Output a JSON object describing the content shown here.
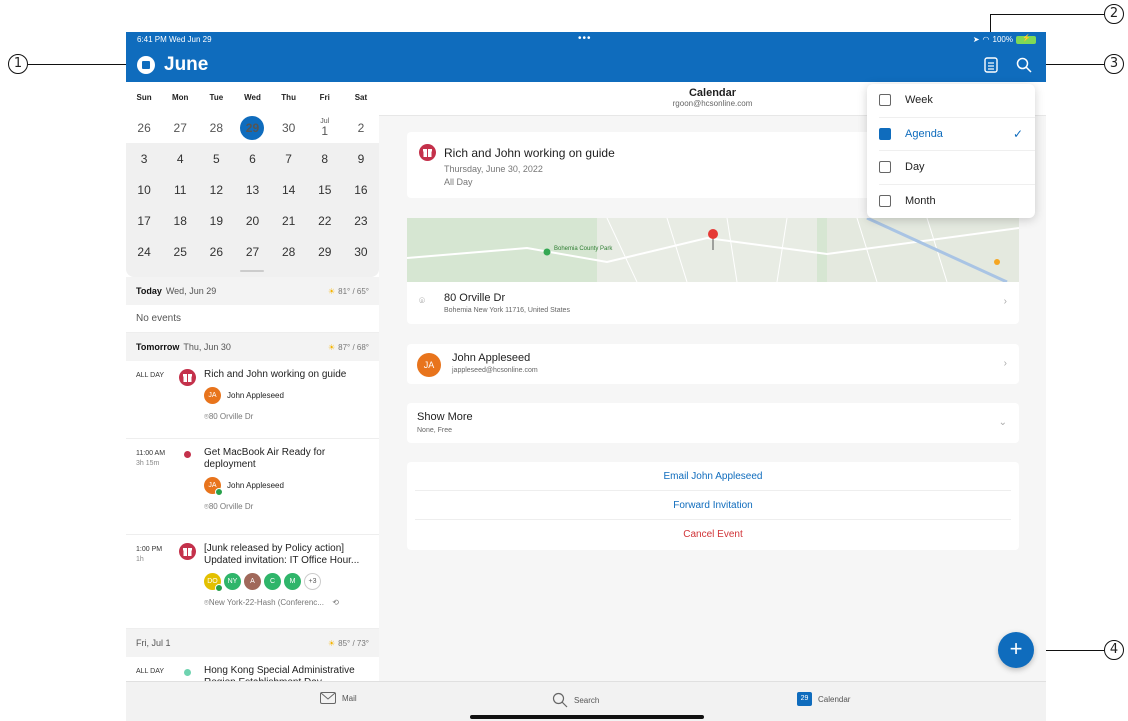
{
  "status": {
    "time": "6:41 PM  Wed Jun 29",
    "dots": "•••",
    "battery": "100%"
  },
  "appbar": {
    "month": "June"
  },
  "callouts": [
    "1",
    "2",
    "3",
    "4"
  ],
  "calendar": {
    "weekdays": [
      "Sun",
      "Mon",
      "Tue",
      "Wed",
      "Thu",
      "Fri",
      "Sat"
    ],
    "weeks": [
      [
        "26",
        "27",
        "28",
        "29",
        "30",
        "1",
        "2"
      ],
      [
        "3",
        "4",
        "5",
        "6",
        "7",
        "8",
        "9"
      ],
      [
        "10",
        "11",
        "12",
        "13",
        "14",
        "15",
        "16"
      ],
      [
        "17",
        "18",
        "19",
        "20",
        "21",
        "22",
        "23"
      ],
      [
        "24",
        "25",
        "26",
        "27",
        "28",
        "29",
        "30"
      ]
    ],
    "jul_label": "Jul"
  },
  "agenda": {
    "today": {
      "label": "Today",
      "date": "Wed, Jun 29",
      "weather": "81° / 65°",
      "empty": "No events"
    },
    "tomorrow": {
      "label": "Tomorrow",
      "date": "Thu, Jun 30",
      "weather": "87° / 68°"
    },
    "events": [
      {
        "time": "ALL DAY",
        "duration": "",
        "title": "Rich and John working on guide",
        "person_initials": "JA",
        "person": "John Appleseed",
        "location": "80 Orville Dr"
      },
      {
        "time": "11:00 AM",
        "duration": "3h 15m",
        "title": "Get MacBook Air Ready for deployment",
        "person_initials": "JA",
        "person": "John Appleseed",
        "location": "80 Orville Dr"
      },
      {
        "time": "1:00 PM",
        "duration": "1h",
        "title": "[Junk released by Policy action] Updated invitation: IT Office Hour...",
        "attendees": [
          "DO",
          "NY",
          "A",
          "C",
          "M"
        ],
        "more": "+3",
        "location": "New York-22-Hash (Conferenc..."
      }
    ],
    "fri": {
      "date": "Fri, Jul 1",
      "weather": "85° / 73°"
    },
    "fri_event": {
      "time": "ALL DAY",
      "title": "Hong Kong Special Administrative Region Establishment Day"
    }
  },
  "detail": {
    "header_title": "Calendar",
    "header_sub": "rgoon@hcsonline.com",
    "event_title": "Rich and John working on guide",
    "event_date": "Thursday, June 30, 2022",
    "event_span": "All Day",
    "map_label": "Bohemia County Park",
    "address": "80 Orville Dr",
    "address_sub": "Bohemia New York 11716, United States",
    "attendee_initials": "JA",
    "attendee_name": "John Appleseed",
    "attendee_email": "jappleseed@hcsonline.com",
    "show_more": "Show More",
    "show_more_sub": "None, Free",
    "actions": [
      "Email John Appleseed",
      "Forward Invitation",
      "Cancel Event"
    ]
  },
  "view_menu": [
    {
      "label": "Week",
      "selected": false
    },
    {
      "label": "Agenda",
      "selected": true
    },
    {
      "label": "Day",
      "selected": false
    },
    {
      "label": "Month",
      "selected": false
    }
  ],
  "tabbar": {
    "mail": "Mail",
    "search": "Search",
    "calendar": "Calendar",
    "calendar_badge": "29"
  },
  "colors": {
    "brand": "#0f6cbd",
    "danger": "#d13438",
    "event_red": "#c4314b",
    "map_green": "#d6e6d2"
  }
}
